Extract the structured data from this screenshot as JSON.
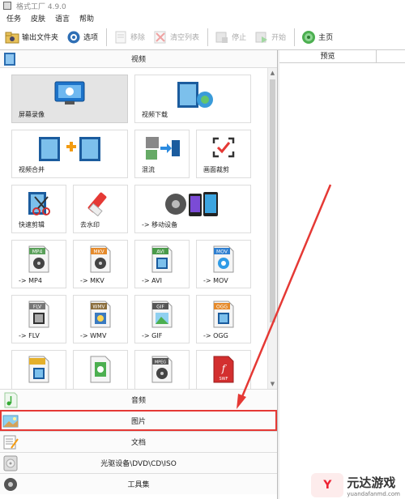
{
  "window": {
    "title": "格式工厂 4.9.0"
  },
  "menu": [
    "任务",
    "皮肤",
    "语言",
    "帮助"
  ],
  "toolbar": {
    "output_folder": "输出文件夹",
    "options": "选项",
    "remove": "移除",
    "clear_list": "清空列表",
    "stop": "停止",
    "start": "开始",
    "home": "主页"
  },
  "video_category": "视频",
  "tiles": [
    {
      "label": "屏幕录像",
      "icon": "screen-record-icon"
    },
    {
      "label": "视频下载",
      "icon": "video-download-icon"
    },
    {
      "label": "视频合并",
      "icon": "video-merge-icon"
    },
    {
      "label": "混流",
      "icon": "mux-icon"
    },
    {
      "label": "画面裁剪",
      "icon": "crop-icon"
    },
    {
      "label": "快速剪辑",
      "icon": "quick-clip-icon"
    },
    {
      "label": "去水印",
      "icon": "remove-watermark-icon"
    },
    {
      "label": "-> 移动设备",
      "icon": "mobile-device-icon"
    },
    {
      "label": "-> MP4",
      "badge": "MP4"
    },
    {
      "label": "-> MKV",
      "badge": "MKV"
    },
    {
      "label": "-> AVI",
      "badge": "AVI"
    },
    {
      "label": "-> MOV",
      "badge": "MOV"
    },
    {
      "label": "-> FLV",
      "badge": "FLV"
    },
    {
      "label": "-> WMV",
      "badge": "WMV"
    },
    {
      "label": "-> GIF",
      "badge": "GIF"
    },
    {
      "label": "-> OGG",
      "badge": "OGG"
    },
    {
      "badge": ""
    },
    {
      "badge": ""
    },
    {
      "badge": "MPEG"
    },
    {
      "badge": "SWF"
    }
  ],
  "categories": [
    {
      "label": "音频",
      "icon": "music-note-icon"
    },
    {
      "label": "图片",
      "icon": "picture-icon"
    },
    {
      "label": "文档",
      "icon": "document-icon"
    },
    {
      "label": "光驱设备\\DVD\\CD\\ISO",
      "icon": "disc-drive-icon"
    },
    {
      "label": "工具集",
      "icon": "toolbox-icon"
    }
  ],
  "right_panel": {
    "column_preview": "预览"
  },
  "watermark": {
    "title": "元达游戏",
    "url": "yuandafanmd.com"
  },
  "colors": {
    "accent_red": "#e53935",
    "selected_tile": "#e4e4e4"
  }
}
